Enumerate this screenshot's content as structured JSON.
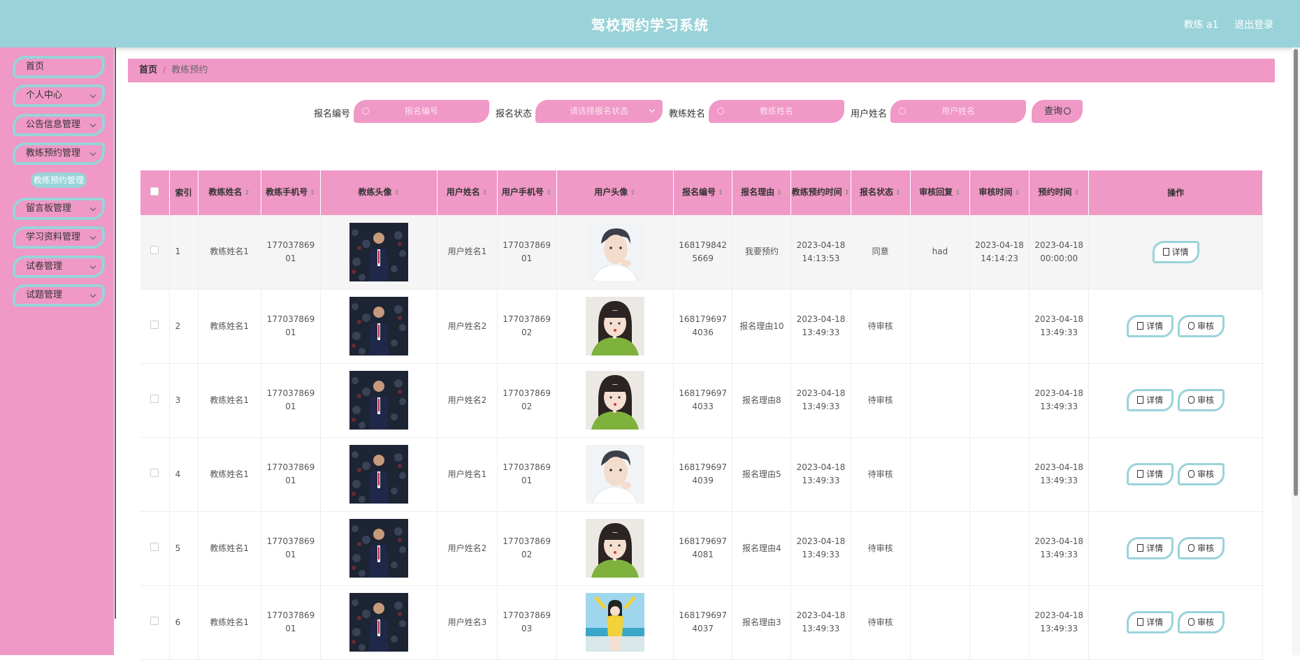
{
  "header": {
    "title": "驾校预约学习系统",
    "user": "教练 a1",
    "logout": "退出登录"
  },
  "sidebar": {
    "items": [
      {
        "label": "首页",
        "chevron": false
      },
      {
        "label": "个人中心",
        "chevron": true
      },
      {
        "label": "公告信息管理",
        "chevron": true
      },
      {
        "label": "教练预约管理",
        "chevron": true
      },
      {
        "label": "留言板管理",
        "chevron": true
      },
      {
        "label": "学习资料管理",
        "chevron": true
      },
      {
        "label": "试卷管理",
        "chevron": true
      },
      {
        "label": "试题管理",
        "chevron": true
      }
    ],
    "sub_item": "教练预约管理"
  },
  "breadcrumb": {
    "home": "首页",
    "separator": "/",
    "current": "教练预约"
  },
  "search": {
    "f1_label": "报名编号",
    "f1_placeholder": "报名编号",
    "f2_label": "报名状态",
    "f2_placeholder": "请选择报名状态",
    "f3_label": "教练姓名",
    "f3_placeholder": "教练姓名",
    "f4_label": "用户姓名",
    "f4_placeholder": "用户姓名",
    "query_label": "查询"
  },
  "table": {
    "columns": [
      "索引",
      "教练姓名",
      "教练手机号",
      "教练头像",
      "用户姓名",
      "用户手机号",
      "用户头像",
      "报名编号",
      "报名理由",
      "教练预约时间",
      "报名状态",
      "审核回复",
      "审核时间",
      "预约时间",
      "操作"
    ],
    "detail_label": "详情",
    "review_label": "审核",
    "rows": [
      {
        "idx": "1",
        "coach": "教练姓名1",
        "coach_phone_a": "177037869",
        "coach_phone_b": "01",
        "user": "用户姓名1",
        "user_phone_a": "177037869",
        "user_phone_b": "01",
        "user_avatar": "male",
        "no_a": "168179842",
        "no_b": "5669",
        "reason": "我要预约",
        "time_a": "2023-04-18",
        "time_b": "14:13:53",
        "status": "同意",
        "reply": "had",
        "review_a": "2023-04-18",
        "review_b": "14:14:23",
        "appt_a": "2023-04-18",
        "appt_b": "00:00:00",
        "can_review": false
      },
      {
        "idx": "2",
        "coach": "教练姓名1",
        "coach_phone_a": "177037869",
        "coach_phone_b": "01",
        "user": "用户姓名2",
        "user_phone_a": "177037869",
        "user_phone_b": "02",
        "user_avatar": "female",
        "no_a": "168179697",
        "no_b": "4036",
        "reason": "报名理由10",
        "time_a": "2023-04-18",
        "time_b": "13:49:33",
        "status": "待审核",
        "reply": "",
        "review_a": "",
        "review_b": "",
        "appt_a": "2023-04-18",
        "appt_b": "13:49:33",
        "can_review": true
      },
      {
        "idx": "3",
        "coach": "教练姓名1",
        "coach_phone_a": "177037869",
        "coach_phone_b": "01",
        "user": "用户姓名2",
        "user_phone_a": "177037869",
        "user_phone_b": "02",
        "user_avatar": "female",
        "no_a": "168179697",
        "no_b": "4033",
        "reason": "报名理由8",
        "time_a": "2023-04-18",
        "time_b": "13:49:33",
        "status": "待审核",
        "reply": "",
        "review_a": "",
        "review_b": "",
        "appt_a": "2023-04-18",
        "appt_b": "13:49:33",
        "can_review": true
      },
      {
        "idx": "4",
        "coach": "教练姓名1",
        "coach_phone_a": "177037869",
        "coach_phone_b": "01",
        "user": "用户姓名1",
        "user_phone_a": "177037869",
        "user_phone_b": "01",
        "user_avatar": "male",
        "no_a": "168179697",
        "no_b": "4039",
        "reason": "报名理由5",
        "time_a": "2023-04-18",
        "time_b": "13:49:33",
        "status": "待审核",
        "reply": "",
        "review_a": "",
        "review_b": "",
        "appt_a": "2023-04-18",
        "appt_b": "13:49:33",
        "can_review": true
      },
      {
        "idx": "5",
        "coach": "教练姓名1",
        "coach_phone_a": "177037869",
        "coach_phone_b": "01",
        "user": "用户姓名2",
        "user_phone_a": "177037869",
        "user_phone_b": "02",
        "user_avatar": "female",
        "no_a": "168179697",
        "no_b": "4081",
        "reason": "报名理由4",
        "time_a": "2023-04-18",
        "time_b": "13:49:33",
        "status": "待审核",
        "reply": "",
        "review_a": "",
        "review_b": "",
        "appt_a": "2023-04-18",
        "appt_b": "13:49:33",
        "can_review": true
      },
      {
        "idx": "6",
        "coach": "教练姓名1",
        "coach_phone_a": "177037869",
        "coach_phone_b": "01",
        "user": "用户姓名3",
        "user_phone_a": "177037869",
        "user_phone_b": "03",
        "user_avatar": "beach",
        "no_a": "168179697",
        "no_b": "4037",
        "reason": "报名理由3",
        "time_a": "2023-04-18",
        "time_b": "13:49:33",
        "status": "待审核",
        "reply": "",
        "review_a": "",
        "review_b": "",
        "appt_a": "2023-04-18",
        "appt_b": "13:49:33",
        "can_review": true
      }
    ]
  }
}
